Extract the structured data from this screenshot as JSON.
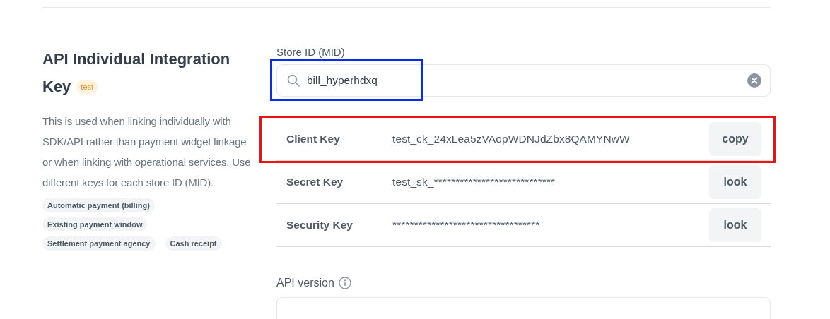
{
  "section": {
    "title_lines": [
      "API Individual Integration",
      "Key"
    ],
    "badge": "test",
    "description": "This is used when linking individually with SDK/API rather than payment widget linkage or when linking with operational services. Use different keys for each store ID (MID).",
    "tags": [
      [
        "Automatic payment (billing)"
      ],
      [
        "Existing payment window"
      ],
      [
        "Settlement payment agency",
        "Cash receipt"
      ]
    ]
  },
  "store_id": {
    "label": "Store ID (MID)",
    "value": "bill_hyperhdxq",
    "color": "#0a2cf0"
  },
  "keys": [
    {
      "label": "Client Key",
      "value": "test_ck_24xLea5zVAopWDNJdZbx8QAMYNwW",
      "button": "copy",
      "color": "#f01010"
    },
    {
      "label": "Secret Key",
      "value": "test_sk_****************************",
      "button": "look"
    },
    {
      "label": "Security Key",
      "value": "**********************************",
      "button": "look"
    }
  ],
  "api_version": {
    "label": "API version"
  }
}
